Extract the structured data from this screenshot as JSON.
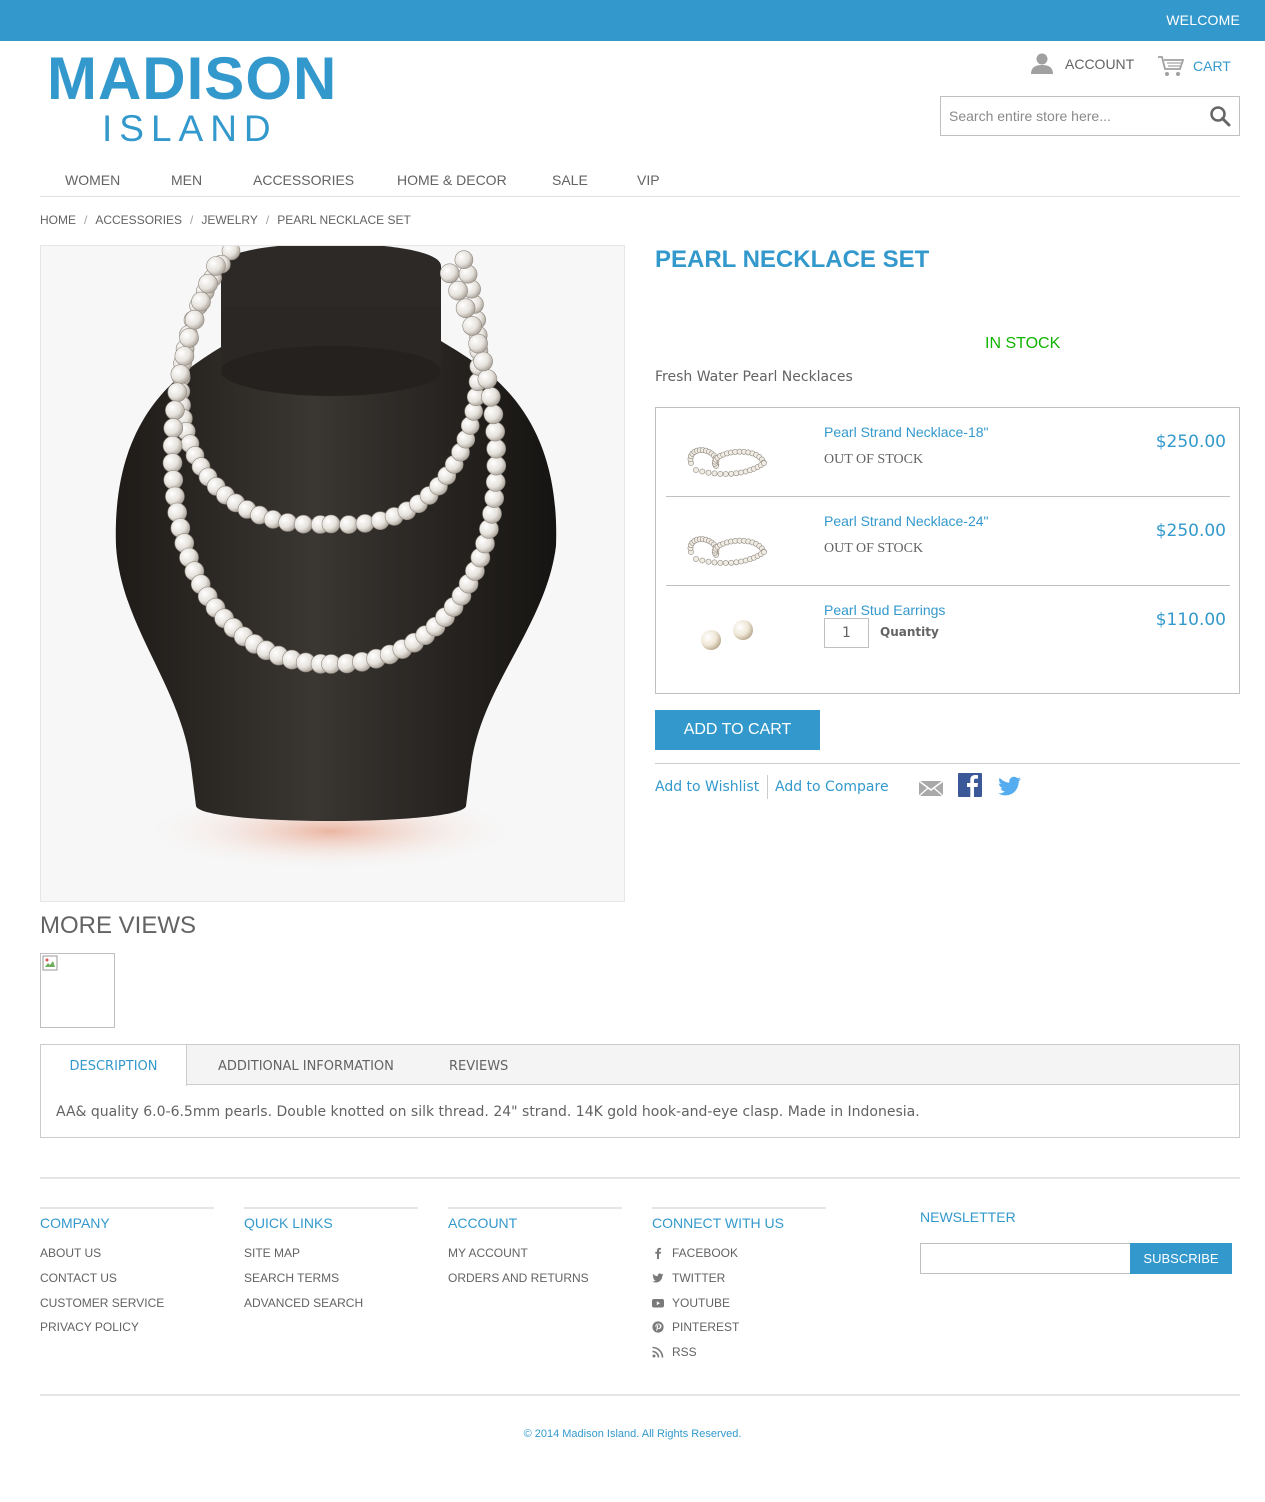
{
  "header": {
    "welcome": "WELCOME",
    "logo_line1": "MADISON",
    "logo_line2": "ISLAND",
    "account": "ACCOUNT",
    "cart": "CART",
    "search_placeholder": "Search entire store here..."
  },
  "nav": [
    "WOMEN",
    "MEN",
    "ACCESSORIES",
    "HOME & DECOR",
    "SALE",
    "VIP"
  ],
  "breadcrumb": [
    "HOME",
    "ACCESSORIES",
    "JEWELRY",
    "PEARL NECKLACE SET"
  ],
  "breadcrumb_sep": "/",
  "product": {
    "name": "PEARL NECKLACE SET",
    "availability": "IN STOCK",
    "short_description": "Fresh Water Pearl Necklaces",
    "more_views_title": "MORE VIEWS",
    "grouped_items": [
      {
        "name": "Pearl Strand Necklace-18\"",
        "status": "OUT OF STOCK",
        "price": "$250.00",
        "icon": "pearl-strand-image"
      },
      {
        "name": "Pearl Strand Necklace-24\"",
        "status": "OUT OF STOCK",
        "price": "$250.00",
        "icon": "pearl-strand-image"
      },
      {
        "name": "Pearl Stud Earrings",
        "quantity": "1",
        "quantity_label": "Quantity",
        "price": "$110.00",
        "icon": "pearl-earrings-image"
      }
    ],
    "add_to_cart": "ADD TO CART",
    "add_to_wishlist": "Add to Wishlist",
    "add_to_compare": "Add to Compare",
    "share_icons": [
      "email-icon",
      "facebook-icon",
      "twitter-icon"
    ]
  },
  "tabs": {
    "items": [
      "DESCRIPTION",
      "ADDITIONAL INFORMATION",
      "REVIEWS"
    ],
    "active": "DESCRIPTION",
    "description": "AA& quality 6.0-6.5mm pearls. Double knotted on silk thread. 24\" strand. 14K gold hook-and-eye clasp. Made in Indonesia."
  },
  "footer": {
    "company": {
      "title": "COMPANY",
      "links": [
        "ABOUT US",
        "CONTACT US",
        "CUSTOMER SERVICE",
        "PRIVACY POLICY"
      ]
    },
    "quick_links": {
      "title": "QUICK LINKS",
      "links": [
        "SITE MAP",
        "SEARCH TERMS",
        "ADVANCED SEARCH"
      ]
    },
    "account": {
      "title": "ACCOUNT",
      "links": [
        "MY ACCOUNT",
        "ORDERS AND RETURNS"
      ]
    },
    "connect": {
      "title": "CONNECT WITH US",
      "links": [
        "FACEBOOK",
        "TWITTER",
        "YOUTUBE",
        "PINTEREST",
        "RSS"
      ]
    },
    "newsletter": {
      "title": "NEWSLETTER",
      "button": "SUBSCRIBE"
    },
    "copyright": "© 2014 Madison Island. All Rights Reserved."
  },
  "colors": {
    "brand": "#3399cc",
    "in_stock": "#11b400",
    "text": "#636363"
  }
}
